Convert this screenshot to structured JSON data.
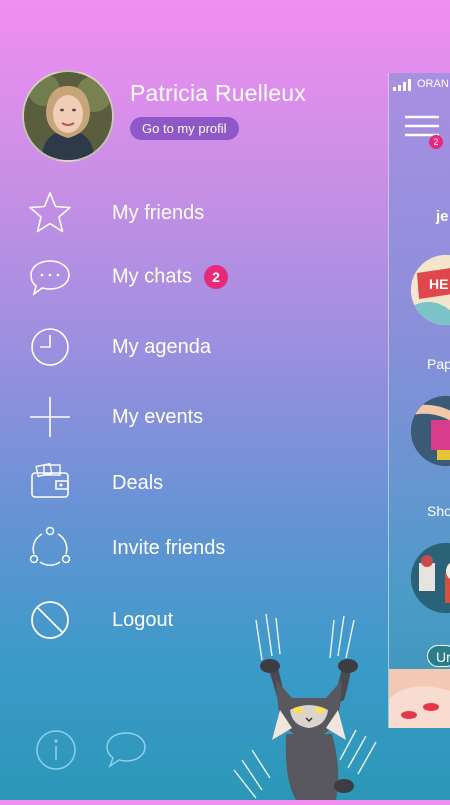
{
  "profile": {
    "name": "Patricia Ruelleux",
    "profile_button": "Go to my profil"
  },
  "menu": {
    "items": [
      {
        "label": "My friends",
        "icon": "star-icon"
      },
      {
        "label": "My chats",
        "icon": "chat-bubble-icon",
        "badge": "2"
      },
      {
        "label": "My agenda",
        "icon": "clock-icon"
      },
      {
        "label": "My events",
        "icon": "plus-icon"
      },
      {
        "label": "Deals",
        "icon": "wallet-icon"
      },
      {
        "label": "Invite friends",
        "icon": "share-icon"
      },
      {
        "label": "Logout",
        "icon": "block-icon"
      }
    ]
  },
  "bottom": {
    "info_icon": "info-icon",
    "feedback_icon": "speech-bubble-icon"
  },
  "preview": {
    "carrier": "ORAN",
    "menu_badge": "2",
    "partial_text": "je",
    "tiles": [
      {
        "label": "Pap",
        "partial_text": "HE"
      },
      {
        "label": "Sho"
      },
      {
        "label": "",
        "button": "Ur"
      }
    ]
  },
  "colors": {
    "badge": "#e8297a",
    "profile_button": "#8e58c9",
    "gradient_top": "#f28ef2",
    "gradient_bottom": "#2b97b8"
  }
}
